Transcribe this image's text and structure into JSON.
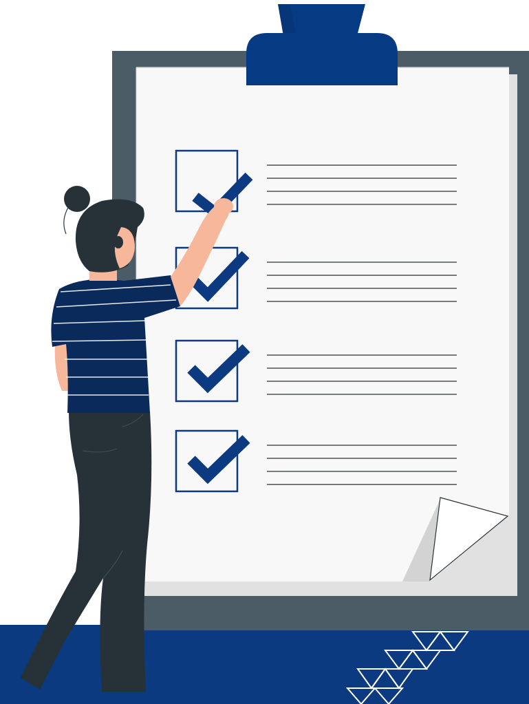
{
  "illustration": {
    "subject": "person-checking-clipboard-checklist",
    "checklist": {
      "items": [
        {
          "checked": true
        },
        {
          "checked": true
        },
        {
          "checked": true
        },
        {
          "checked": true
        }
      ],
      "lines_per_item": 4
    },
    "icons": [
      "clipboard-icon",
      "checkbox-icon",
      "checkmark-icon",
      "person-figure",
      "triangle-pattern-icon"
    ],
    "colors": {
      "navy": "#0b3a80",
      "clip_blue": "#063a82",
      "board_slate": "#4b5c67",
      "paper": "#f7f7f7",
      "paper_shadow": "#e3e3e3",
      "hair_dark": "#263238",
      "skin": "#f7b79b",
      "pants_dark": "#263238",
      "floor_band": "#0b3a80",
      "background": "#ffffff"
    }
  }
}
